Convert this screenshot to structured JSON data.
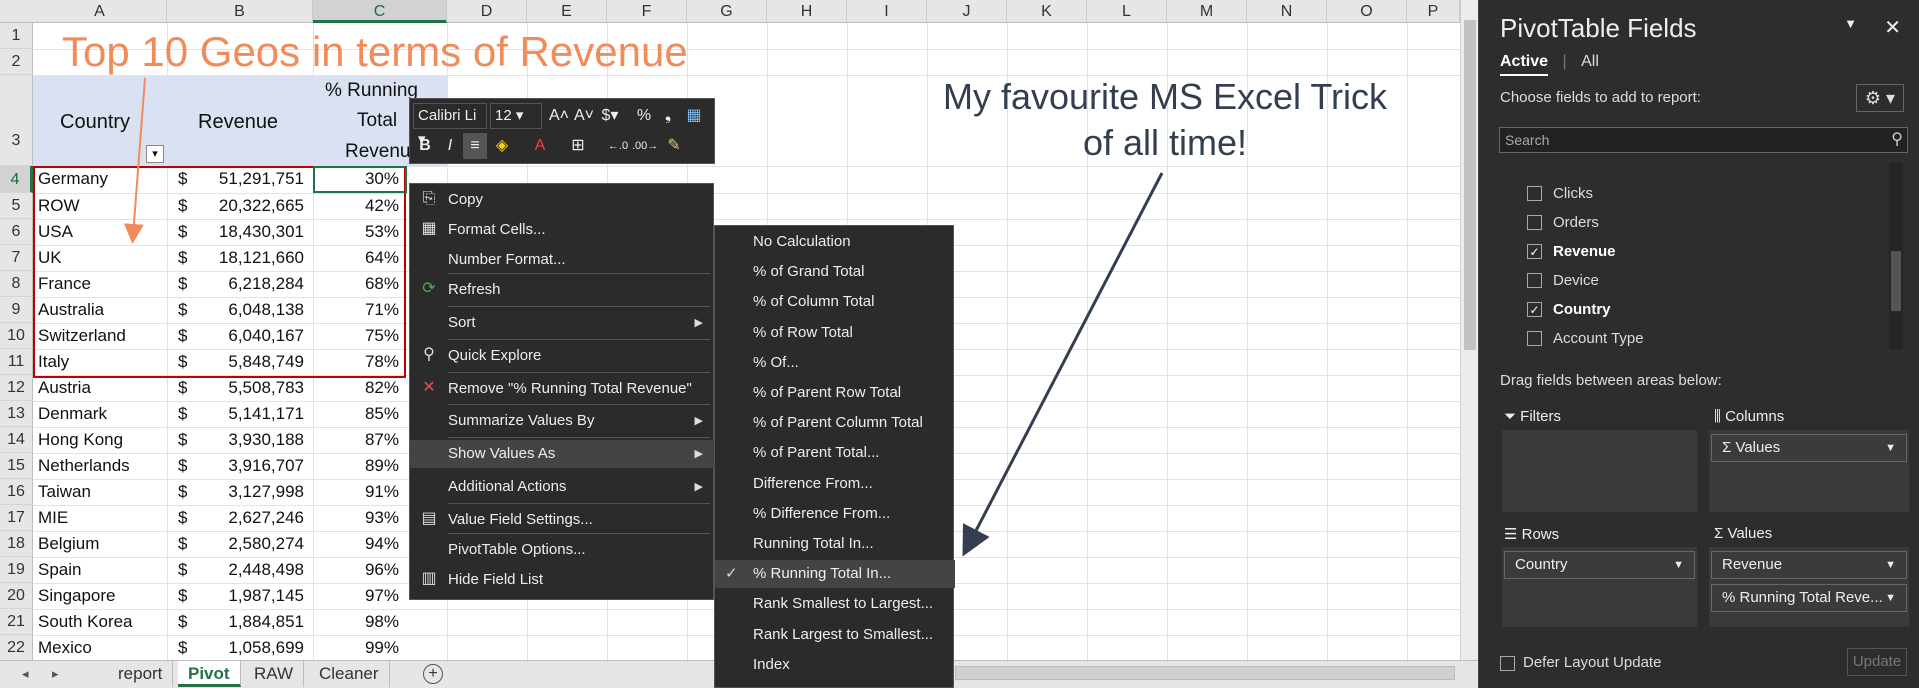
{
  "columns": [
    "A",
    "B",
    "C",
    "D",
    "E",
    "F",
    "G",
    "H",
    "I",
    "J",
    "K",
    "L",
    "M",
    "N",
    "O",
    "P"
  ],
  "rows": [
    "1",
    "2",
    "3",
    "4",
    "5",
    "6",
    "7",
    "8",
    "9",
    "10",
    "11",
    "12",
    "13",
    "14",
    "15",
    "16",
    "17",
    "18",
    "19",
    "20",
    "21",
    "22"
  ],
  "title": "Top 10 Geos in terms of Revenue",
  "annotation_line1": "My favourite MS Excel Trick",
  "annotation_line2": "of all time!",
  "header": {
    "country": "Country",
    "revenue": "Revenue",
    "pct1": "% Running",
    "pct2": "Total",
    "pct3": "Revenu"
  },
  "table": [
    {
      "country": "Germany",
      "cur": "$",
      "rev": "51,291,751",
      "pct": "30%"
    },
    {
      "country": "ROW",
      "cur": "$",
      "rev": "20,322,665",
      "pct": "42%"
    },
    {
      "country": "USA",
      "cur": "$",
      "rev": "18,430,301",
      "pct": "53%"
    },
    {
      "country": "UK",
      "cur": "$",
      "rev": "18,121,660",
      "pct": "64%"
    },
    {
      "country": "France",
      "cur": "$",
      "rev": "6,218,284",
      "pct": "68%"
    },
    {
      "country": "Australia",
      "cur": "$",
      "rev": "6,048,138",
      "pct": "71%"
    },
    {
      "country": "Switzerland",
      "cur": "$",
      "rev": "6,040,167",
      "pct": "75%"
    },
    {
      "country": "Italy",
      "cur": "$",
      "rev": "5,848,749",
      "pct": "78%"
    },
    {
      "country": "Austria",
      "cur": "$",
      "rev": "5,508,783",
      "pct": "82%"
    },
    {
      "country": "Denmark",
      "cur": "$",
      "rev": "5,141,171",
      "pct": "85%"
    },
    {
      "country": "Hong Kong",
      "cur": "$",
      "rev": "3,930,188",
      "pct": "87%"
    },
    {
      "country": "Netherlands",
      "cur": "$",
      "rev": "3,916,707",
      "pct": "89%"
    },
    {
      "country": "Taiwan",
      "cur": "$",
      "rev": "3,127,998",
      "pct": "91%"
    },
    {
      "country": "MIE",
      "cur": "$",
      "rev": "2,627,246",
      "pct": "93%"
    },
    {
      "country": "Belgium",
      "cur": "$",
      "rev": "2,580,274",
      "pct": "94%"
    },
    {
      "country": "Spain",
      "cur": "$",
      "rev": "2,448,498",
      "pct": "96%"
    },
    {
      "country": "Singapore",
      "cur": "$",
      "rev": "1,987,145",
      "pct": "97%"
    },
    {
      "country": "South Korea",
      "cur": "$",
      "rev": "1,884,851",
      "pct": "98%"
    },
    {
      "country": "Mexico",
      "cur": "$",
      "rev": "1,058,699",
      "pct": "99%"
    }
  ],
  "sheet_tabs": [
    "report",
    "Pivot",
    "RAW",
    "Cleaner"
  ],
  "minibar": {
    "font": "Calibri Li",
    "size": "12"
  },
  "context_menu": [
    {
      "label": "Copy",
      "icon": "⎘"
    },
    {
      "label": "Format Cells...",
      "icon": "▦"
    },
    {
      "label": "Number Format...",
      "icon": ""
    },
    {
      "label": "Refresh",
      "icon": "⟳"
    },
    {
      "label": "Sort",
      "icon": "",
      "sub": true
    },
    {
      "label": "Quick Explore",
      "icon": "⚲"
    },
    {
      "label": "Remove \"% Running Total Revenue\"",
      "icon": "✕"
    },
    {
      "label": "Summarize Values By",
      "icon": "",
      "sub": true
    },
    {
      "label": "Show Values As",
      "icon": "",
      "sub": true
    },
    {
      "label": "Additional Actions",
      "icon": "",
      "sub": true
    },
    {
      "label": "Value Field Settings...",
      "icon": "▤"
    },
    {
      "label": "PivotTable Options...",
      "icon": ""
    },
    {
      "label": "Hide Field List",
      "icon": "▥"
    }
  ],
  "submenu": [
    "No Calculation",
    "% of Grand Total",
    "% of Column Total",
    "% of Row Total",
    "% Of...",
    "% of Parent Row Total",
    "% of Parent Column Total",
    "% of Parent Total...",
    "Difference From...",
    "% Difference From...",
    "Running Total In...",
    "% Running Total In...",
    "Rank Smallest to Largest...",
    "Rank Largest to Smallest...",
    "Index"
  ],
  "pane": {
    "title": "PivotTable Fields",
    "tab_active": "Active",
    "tab_all": "All",
    "choose": "Choose fields to add to report:",
    "search_placeholder": "Search",
    "fields": [
      {
        "name": "Clicks",
        "on": false
      },
      {
        "name": "Orders",
        "on": false
      },
      {
        "name": "Revenue",
        "on": true
      },
      {
        "name": "Device",
        "on": false
      },
      {
        "name": "Country",
        "on": true
      },
      {
        "name": "Account Type",
        "on": false
      }
    ],
    "drag": "Drag fields between areas below:",
    "filters": "Filters",
    "columns": "Columns",
    "rows": "Rows",
    "values": "Values",
    "col_pill": "Σ Values",
    "row_pill": "Country",
    "val_pill1": "Revenue",
    "val_pill2": "% Running Total Reve...",
    "defer": "Defer Layout Update",
    "update": "Update"
  }
}
